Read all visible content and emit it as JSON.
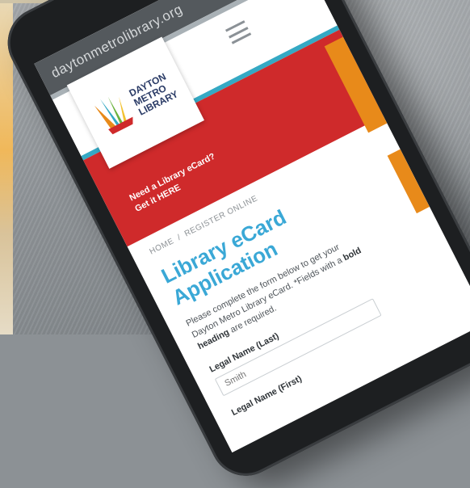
{
  "browser": {
    "url": "daytonmetrolibrary.org"
  },
  "logo": {
    "line1": "DAYTON",
    "line2": "METRO",
    "line3": "LIBRARY"
  },
  "promo": {
    "line1": "Need a Library eCard?",
    "line2": "Get it HERE"
  },
  "breadcrumb": {
    "home": "HOME",
    "separator": "/",
    "current": "REGISTER ONLINE"
  },
  "form": {
    "title": "Library eCard Application",
    "description_start": "Please complete the form below to get your Dayton Metro Library eCard.",
    "description_note_prefix": "*Fields with a",
    "description_note_bold": "bold heading",
    "description_note_suffix": "are required.",
    "last_name_label": "Legal Name (Last)",
    "last_name_placeholder": "Smith",
    "first_name_label": "Legal Name (First)"
  },
  "colors": {
    "red": "#cf2a2b",
    "teal": "#35a9c4",
    "orange": "#e88a1a",
    "title_blue": "#3aa8d6"
  },
  "icons": {
    "menu": "hamburger-menu-icon",
    "logo": "library-logo-icon"
  }
}
